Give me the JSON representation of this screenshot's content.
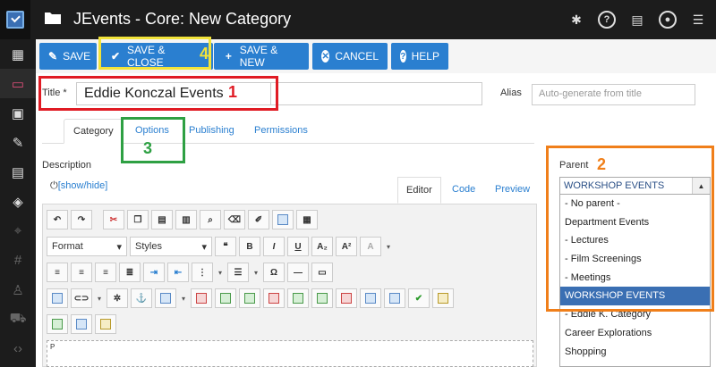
{
  "window": {
    "title": "JEvents - Core: New Category"
  },
  "topbar_icons": [
    "joomla-icon",
    "help-icon",
    "notification-icon",
    "user-icon",
    "settings-icon"
  ],
  "sidebar": {
    "items": [
      {
        "icon": "calendar-icon"
      },
      {
        "icon": "category-icon",
        "active": true
      },
      {
        "icon": "events-icon"
      },
      {
        "icon": "edit-icon"
      },
      {
        "icon": "document-icon"
      },
      {
        "icon": "paint-icon"
      },
      {
        "icon": "location-icon"
      },
      {
        "icon": "tag-icon"
      },
      {
        "icon": "user-icon"
      },
      {
        "icon": "cart-icon"
      },
      {
        "icon": "code-icon"
      }
    ]
  },
  "toolbar": {
    "save": "SAVE",
    "save_close": "SAVE & CLOSE",
    "save_new": "SAVE & NEW",
    "cancel": "CANCEL",
    "help": "HELP"
  },
  "form": {
    "title_label": "Title *",
    "title_value": "Eddie Konczal Events",
    "alias_label": "Alias",
    "alias_placeholder": "Auto-generate from title"
  },
  "tabs": [
    "Category",
    "Options",
    "Publishing",
    "Permissions"
  ],
  "description": {
    "label": "Description",
    "show_hide": "[show/hide]",
    "editor_tabs": [
      "Editor",
      "Code",
      "Preview"
    ],
    "format_select": "Format",
    "styles_select": "Styles",
    "content_preview": "P"
  },
  "parent": {
    "label": "Parent",
    "selected": "WORKSHOP EVENTS",
    "options": [
      "- No parent -",
      "Department Events",
      "- Lectures",
      "- Film Screenings",
      "- Meetings",
      "WORKSHOP EVENTS",
      "- Eddie K. Category",
      "Career Explorations",
      "Shopping"
    ]
  },
  "annotations": {
    "n1": "1",
    "n2": "2",
    "n3": "3",
    "n4": "4",
    "colors": {
      "red": "#e01b24",
      "orange": "#f07f1a",
      "green": "#2ea043",
      "yellow": "#f2e33a"
    }
  },
  "colors": {
    "accent": "#2a7fd0",
    "topbar": "#1c1c1c",
    "selected": "#3a6fb3"
  }
}
